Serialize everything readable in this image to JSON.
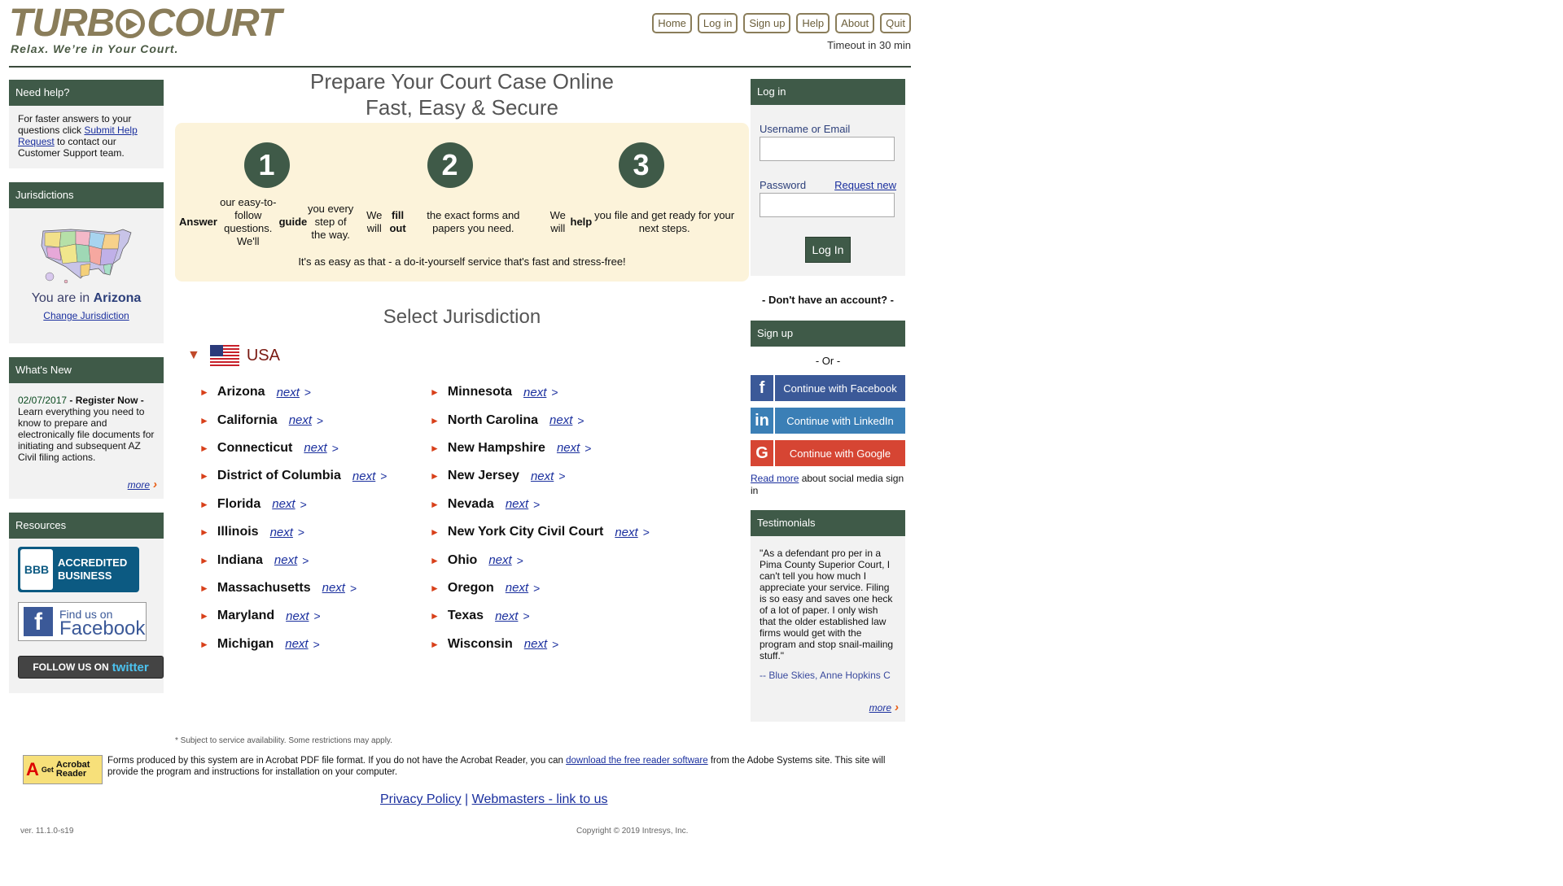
{
  "brand": {
    "logo_part1": "TURB",
    "logo_part2": "COURT",
    "tagline": "Relax.  We’re in Your Court."
  },
  "topnav": [
    "Home",
    "Log in",
    "Sign up",
    "Help",
    "About",
    "Quit"
  ],
  "timeout": "Timeout in 30 min",
  "help": {
    "title": "Need help?",
    "text_before": "For faster answers to your questions click ",
    "link": "Submit Help Request",
    "text_after": " to contact our Customer Support team."
  },
  "jurisdictions": {
    "title": "Jurisdictions",
    "you_are": "You are in ",
    "state": "Arizona",
    "change": "Change Jurisdiction"
  },
  "whats_new": {
    "title": "What's New",
    "date": "02/07/2017",
    "headline": " - Register Now - ",
    "body": "Learn everything you need to know to prepare and electronically file documents for initiating and subsequent AZ Civil filing actions.",
    "more": "more"
  },
  "resources": {
    "title": "Resources",
    "bbb_line1": "ACCREDITED",
    "bbb_line2": "BUSINESS",
    "bbb_logo": "BBB",
    "fb_small": "Find us on",
    "fb_big": "Facebook",
    "twitter_prefix": "FOLLOW US ON",
    "twitter_name": "twitter"
  },
  "hero": {
    "line1": "Prepare Your Court Case Online",
    "line2": "Fast, Easy & Secure"
  },
  "steps": [
    {
      "num": "1",
      "html": "<b>Answer</b> our easy-to-follow questions. We'll <b>guide</b> you every step of the way."
    },
    {
      "num": "2",
      "html": "We will <b>fill out</b> the exact forms and papers you need."
    },
    {
      "num": "3",
      "html": "We will <b>help</b> you file and get ready for your next steps."
    }
  ],
  "steps_footer": "It's as easy as that - a do-it-yourself service that's fast and stress-free!",
  "select_title": "Select Jurisdiction",
  "country": "USA",
  "next_label": "next",
  "jurisdiction_left": [
    "Arizona",
    "California",
    "Connecticut",
    "District of Columbia",
    "Florida",
    "Illinois",
    "Indiana",
    "Massachusetts",
    "Maryland",
    "Michigan"
  ],
  "jurisdiction_right": [
    "Minnesota",
    "North Carolina",
    "New Hampshire",
    "New Jersey",
    "Nevada",
    "New York City Civil Court",
    "Ohio",
    "Oregon",
    "Texas",
    "Wisconsin"
  ],
  "subject_note": "* Subject to service availability. Some restrictions may apply.",
  "login": {
    "title": "Log in",
    "username_label": "Username or Email",
    "password_label": "Password",
    "request_new": "Request new",
    "button": "Log In"
  },
  "no_account": "- Don't have an account? -",
  "signup": {
    "title": "Sign up",
    "or": "- Or -",
    "facebook": "Continue with Facebook",
    "linkedin": "Continue with LinkedIn",
    "google": "Continue with Google",
    "read_more": "Read more",
    "read_more_rest": " about social media sign in"
  },
  "testimonials": {
    "title": "Testimonials",
    "quote": "\"As a defendant pro per in a Pima County Superior Court, I can't tell you how much I appreciate your service. Filing is so easy and saves one heck of a lot of paper. I only wish that the older established law firms would get with the program and stop snail-mailing stuff.\"",
    "author": "-- Blue Skies, Anne Hopkins C",
    "more": "more"
  },
  "acrobat": {
    "badge_get": "Get",
    "badge_name": "Acrobat Reader",
    "text_before": "Forms produced by this system are in Acrobat PDF file format. If you do not have the Acrobat Reader, you can ",
    "link": "download the free reader software",
    "text_after": " from the Adobe Systems site. This site will provide the program and instructions for installation on your computer."
  },
  "footer": {
    "privacy": "Privacy Policy",
    "webmasters": "Webmasters - link to us",
    "version": "ver. 11.1.0-s19",
    "copyright": "Copyright © 2019 Intresys, Inc."
  },
  "colors": {
    "brand_gold": "#8a7d5a",
    "header_green": "#3f5a48",
    "steps_bg": "#fcf3da",
    "link_blue": "#1a2f9e",
    "arrow_orange": "#d8401a"
  }
}
